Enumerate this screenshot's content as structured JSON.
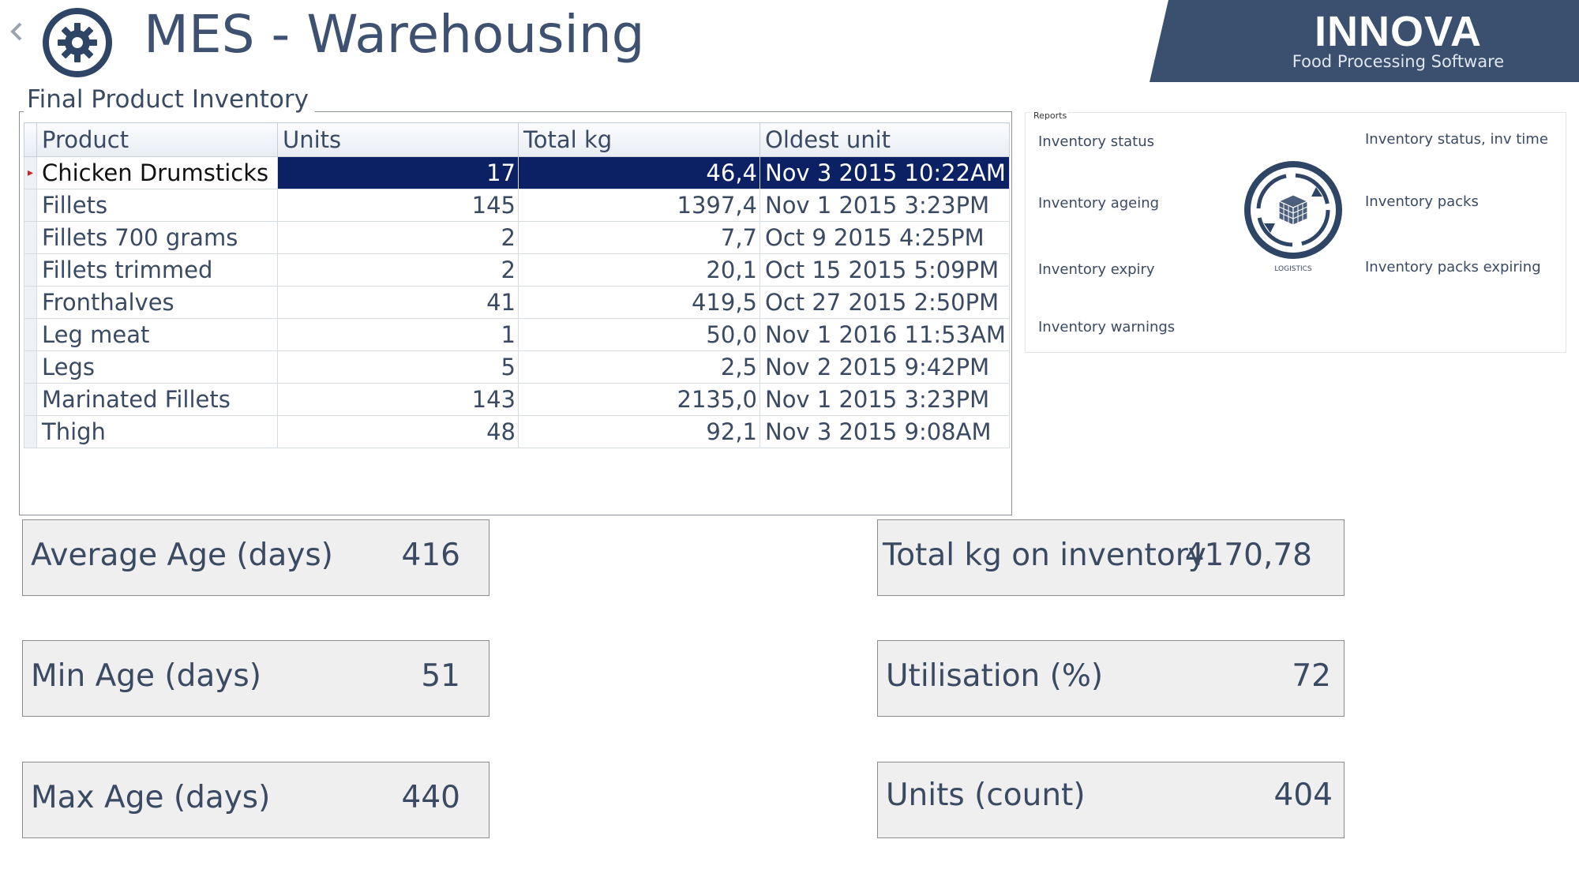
{
  "header": {
    "title": "MES - Warehousing",
    "back_icon": "chevron-left-icon",
    "app_icon": "gear-icon",
    "brand_name": "INNOVA",
    "brand_tagline": "Food Processing Software",
    "brand_color": "#3b4f6e"
  },
  "inventory": {
    "group_title": "Final Product Inventory",
    "columns": [
      "Product",
      "Units",
      "Total kg",
      "Oldest unit"
    ],
    "rows": [
      {
        "product": "Chicken Drumsticks",
        "units": "17",
        "total_kg": "46,4",
        "oldest_unit": "Nov  3 2015 10:22AM",
        "selected": true
      },
      {
        "product": "Fillets",
        "units": "145",
        "total_kg": "1397,4",
        "oldest_unit": "Nov  1 2015  3:23PM"
      },
      {
        "product": "Fillets 700 grams",
        "units": "2",
        "total_kg": "7,7",
        "oldest_unit": "Oct  9 2015  4:25PM"
      },
      {
        "product": "Fillets trimmed",
        "units": "2",
        "total_kg": "20,1",
        "oldest_unit": "Oct 15 2015  5:09PM"
      },
      {
        "product": "Fronthalves",
        "units": "41",
        "total_kg": "419,5",
        "oldest_unit": "Oct 27 2015  2:50PM"
      },
      {
        "product": "Leg meat",
        "units": "1",
        "total_kg": "50,0",
        "oldest_unit": "Nov  1 2016 11:53AM"
      },
      {
        "product": "Legs",
        "units": "5",
        "total_kg": "2,5",
        "oldest_unit": "Nov  2 2015  9:42PM"
      },
      {
        "product": "Marinated Fillets",
        "units": "143",
        "total_kg": "2135,0",
        "oldest_unit": "Nov  1 2015  3:23PM"
      },
      {
        "product": "Thigh",
        "units": "48",
        "total_kg": "92,1",
        "oldest_unit": "Nov  3 2015  9:08AM"
      }
    ],
    "selection_color": "#0c2164"
  },
  "reports": {
    "title": "Reports",
    "left_links": [
      "Inventory status",
      "Inventory ageing",
      "Inventory expiry",
      "Inventory warnings"
    ],
    "right_links": [
      "Inventory status, inv time",
      "Inventory packs",
      "Inventory packs expiring"
    ],
    "logo_label": "LOGISTICS",
    "logo_icon": "logistics-cube-icon"
  },
  "kpis": {
    "avg_age": {
      "label": "Average Age (days)",
      "value": "416"
    },
    "min_age": {
      "label": "Min Age (days)",
      "value": "51"
    },
    "max_age": {
      "label": "Max Age (days)",
      "value": "440"
    },
    "total_kg": {
      "label": "Total kg on inventory",
      "value": "4170,78"
    },
    "utilisation": {
      "label": "Utilisation (%)",
      "value": "72"
    },
    "units": {
      "label": "Units (count)",
      "value": "404"
    }
  }
}
